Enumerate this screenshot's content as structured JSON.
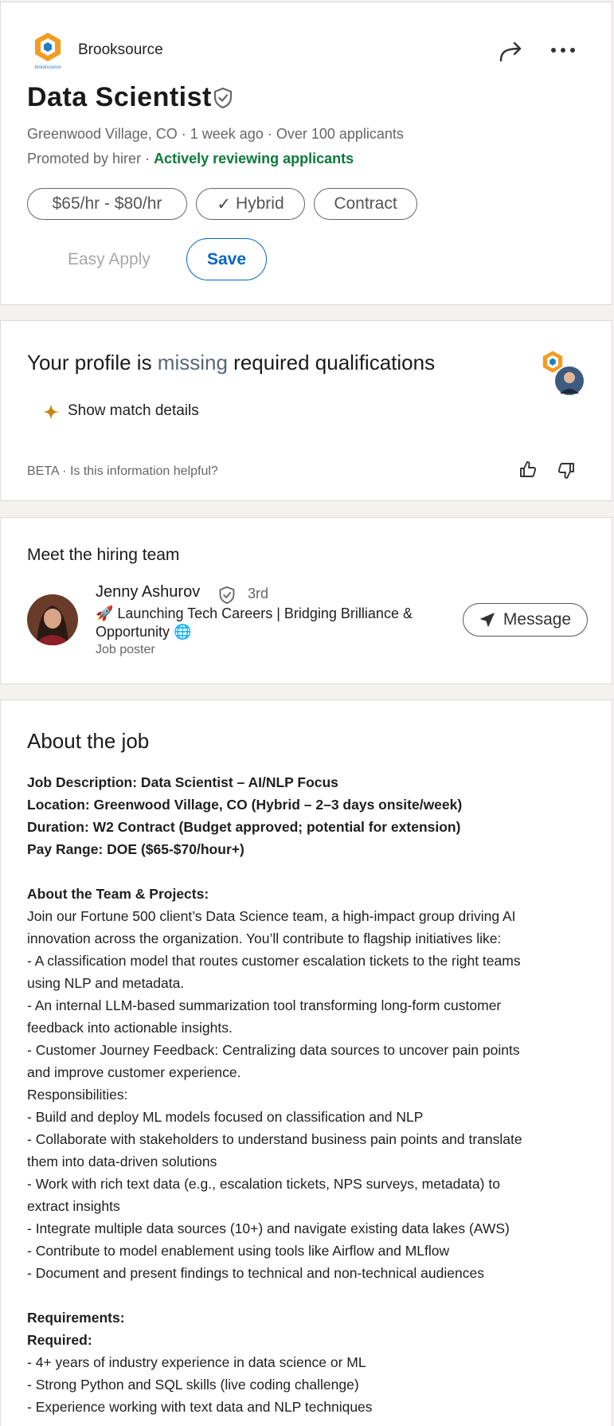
{
  "header": {
    "company": "Brooksource",
    "logo_caption": "brooksource",
    "title": "Data Scientist",
    "meta_line": "Greenwood Village, CO · 1 week ago · Over 100 applicants",
    "promoted": "Promoted by hirer · ",
    "actively": "Actively reviewing applicants",
    "pills": [
      "$65/hr - $80/hr",
      "Hybrid",
      "Contract"
    ],
    "hybrid_check": "✓",
    "easy_apply": "Easy Apply",
    "save": "Save"
  },
  "profile": {
    "heading_pre": "Your profile is ",
    "heading_missing": "missing",
    "heading_post": " required qualifications",
    "match": "Show match details",
    "beta": "BETA · Is this information helpful?"
  },
  "hiring": {
    "heading": "Meet the hiring team",
    "name": "Jenny Ashurov",
    "degree": "3rd",
    "headline": "🚀 Launching Tech Careers | Bridging Brilliance & Opportunity",
    "globe": "🌐",
    "poster": "Job poster",
    "message": "Message"
  },
  "about": {
    "heading": "About the job",
    "lines": [
      {
        "text": "Job Description: Data Scientist – AI/NLP Focus",
        "bold": true
      },
      {
        "text": "Location: Greenwood Village, CO (Hybrid – 2–3 days onsite/week)",
        "bold": true
      },
      {
        "text": "Duration: W2 Contract (Budget approved; potential for extension)",
        "bold": true
      },
      {
        "text": "Pay Range: DOE ($65-$70/hour+)",
        "bold": true
      },
      {
        "text": "",
        "bold": false
      },
      {
        "text": "About the Team & Projects:",
        "bold": true
      },
      {
        "text": "Join our Fortune 500 client’s Data Science team, a high-impact group driving AI",
        "bold": false
      },
      {
        "text": "innovation across the organization. You’ll contribute to flagship initiatives like:",
        "bold": false
      },
      {
        "text": "- A classification model that routes customer escalation tickets to the right teams",
        "bold": false
      },
      {
        "text": "using NLP and metadata.",
        "bold": false
      },
      {
        "text": "- An internal LLM-based summarization tool transforming long-form customer",
        "bold": false
      },
      {
        "text": "feedback into actionable insights.",
        "bold": false
      },
      {
        "text": "- Customer Journey Feedback: Centralizing data sources to uncover pain points",
        "bold": false
      },
      {
        "text": "and improve customer experience.",
        "bold": false
      },
      {
        "text": "Responsibilities:",
        "bold": false
      },
      {
        "text": "- Build and deploy ML models focused on classification and NLP",
        "bold": false
      },
      {
        "text": "- Collaborate with stakeholders to understand business pain points and translate",
        "bold": false
      },
      {
        "text": "them into data-driven solutions",
        "bold": false
      },
      {
        "text": "- Work with rich text data (e.g., escalation tickets, NPS surveys, metadata) to",
        "bold": false
      },
      {
        "text": "extract insights",
        "bold": false
      },
      {
        "text": "- Integrate multiple data sources (10+) and navigate existing data lakes (AWS)",
        "bold": false
      },
      {
        "text": "- Contribute to model enablement using tools like Airflow and MLflow",
        "bold": false
      },
      {
        "text": "- Document and present findings to technical and non-technical audiences",
        "bold": false
      },
      {
        "text": "",
        "bold": false
      },
      {
        "text": "Requirements:",
        "bold": true
      },
      {
        "text": "Required:",
        "bold": true
      },
      {
        "text": "- 4+ years of industry experience in data science or ML",
        "bold": false
      },
      {
        "text": "- Strong Python and SQL skills (live coding challenge)",
        "bold": false
      },
      {
        "text": "- Experience working with text data and NLP techniques",
        "bold": false
      }
    ]
  },
  "colors": {
    "accent_blue": "#0a66c2",
    "active_green": "#0a7a3b",
    "logo_orange": "#f39c23",
    "logo_blue": "#1f7fc4",
    "missing_slate": "#56687a"
  }
}
